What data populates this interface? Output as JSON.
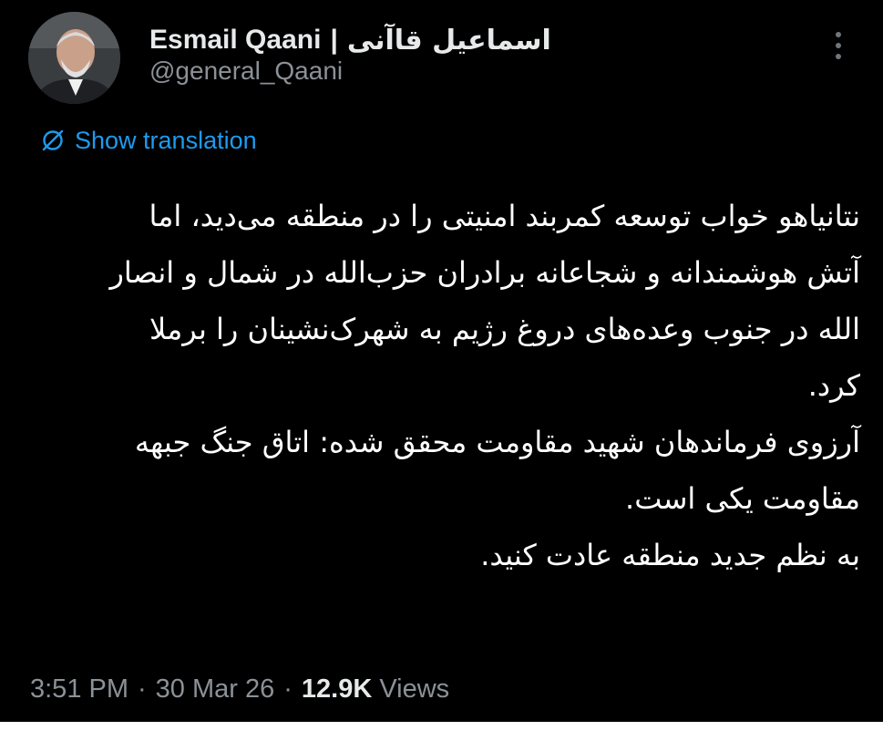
{
  "user": {
    "display_name": "Esmail Qaani",
    "separator": "|",
    "display_name_fa": "اسماعیل قاآنی",
    "handle": "@general_Qaani"
  },
  "icons": {
    "translate": "globe-slash-icon",
    "more": "more-vertical-icon"
  },
  "translation": {
    "label": "Show translation"
  },
  "tweet": {
    "paragraphs": [
      "نتانیاهو خواب توسعه کمربند امنیتی را در منطقه می‌دید، اما\nآتش هوشمندانه و شجاعانه برادران حزب‌الله در شمال و انصار\nالله در جنوب وعده‌های دروغ رژیم به شهرک‌نشینان را برملا\nکرد.",
      "آرزوی فرماندهان شهید مقاومت محقق شده: اتاق جنگ جبهه\nمقاومت یکی است.",
      "به نظم جدید منطقه عادت کنید."
    ]
  },
  "meta": {
    "time": "3:51 PM",
    "dot": "·",
    "date": "30 Mar 26",
    "views_count": "12.9K",
    "views_label": "Views"
  },
  "colors": {
    "background": "#000000",
    "text_primary": "#e7e9ea",
    "text_secondary": "#8b9198",
    "accent_link": "#1d9bf0"
  }
}
